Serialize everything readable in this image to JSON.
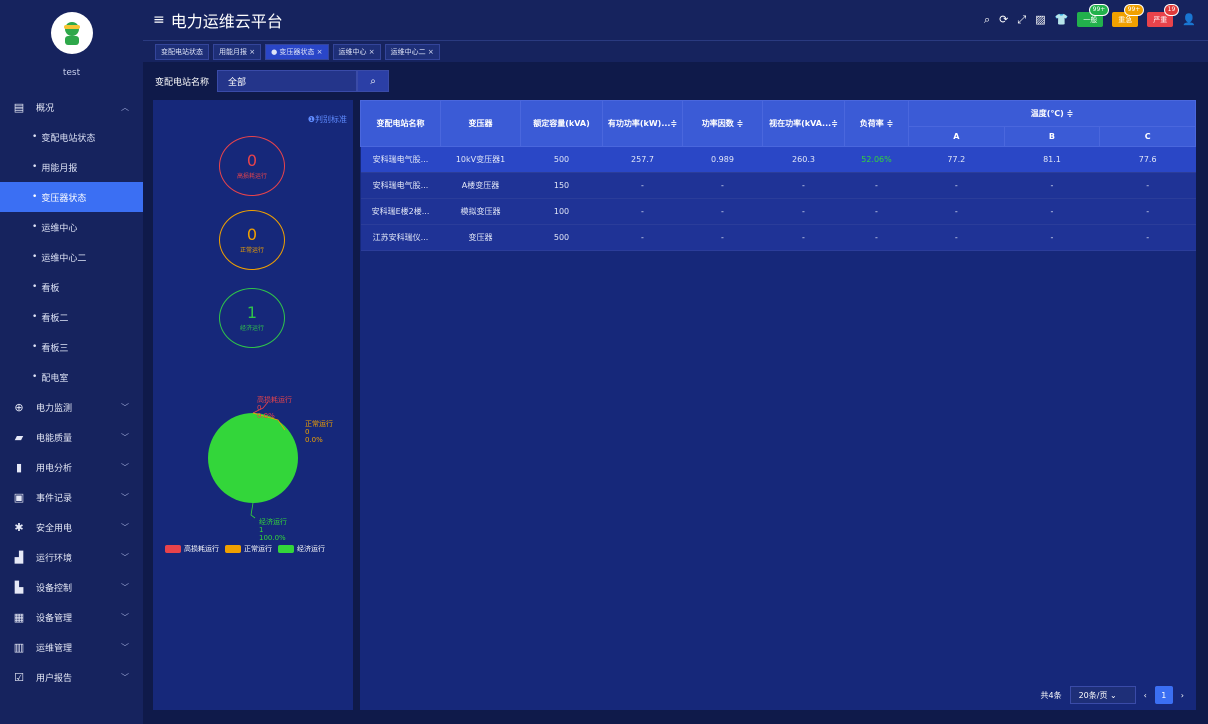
{
  "app": {
    "title": "电力运维云平台",
    "user": "test"
  },
  "sidebar": {
    "overview": "概况",
    "sub": [
      "变配电站状态",
      "用能月报",
      "变压器状态",
      "运维中心",
      "运维中心二",
      "看板",
      "看板二",
      "看板三",
      "配电室"
    ],
    "groups": [
      "电力监测",
      "电能质量",
      "用电分析",
      "事件记录",
      "安全用电",
      "运行环境",
      "设备控制",
      "设备管理",
      "运维管理",
      "用户报告"
    ]
  },
  "tools": {
    "badges": [
      {
        "label": "一般",
        "count": "99+",
        "color": "#22b14c"
      },
      {
        "label": "重急",
        "count": "99+",
        "color": "#f0a000"
      },
      {
        "label": "严重",
        "count": "19",
        "color": "#e8434b"
      }
    ]
  },
  "tabs": [
    "变配电站状态",
    "用能月报 ×",
    "● 变压器状态 ×",
    "运维中心 ×",
    "运维中心二 ×"
  ],
  "filter": {
    "label": "变配电站名称",
    "value": "全部"
  },
  "left": {
    "judge": "❶判别标准",
    "rings": [
      {
        "n": "0",
        "l": "高损耗运行"
      },
      {
        "n": "0",
        "l": "正常运行"
      },
      {
        "n": "1",
        "l": "经济运行"
      }
    ],
    "pie": {
      "high": "高损耗运行\n0\n0.0%",
      "normal": "正常运行\n0\n0.0%",
      "eco": "经济运行\n1\n100.0%"
    },
    "legend": [
      "高损耗运行",
      "正常运行",
      "经济运行"
    ]
  },
  "table": {
    "headers": [
      "变配电站名称",
      "变压器",
      "额定容量(kVA)",
      "有功功率(kW)...≑",
      "功率因数 ≑",
      "视在功率(kVA...≑",
      "负荷率 ≑",
      "温度(℃) ≑"
    ],
    "temp_cols": [
      "A",
      "B",
      "C"
    ],
    "rows": [
      [
        "安科瑞电气股...",
        "10kV变压器1",
        "500",
        "257.7",
        "0.989",
        "260.3",
        "52.06%",
        "77.2",
        "81.1",
        "77.6"
      ],
      [
        "安科瑞电气股...",
        "A楼变压器",
        "150",
        "-",
        "-",
        "-",
        "-",
        "-",
        "-",
        "-"
      ],
      [
        "安科瑞E楼2楼...",
        "模拟变压器",
        "100",
        "-",
        "-",
        "-",
        "-",
        "-",
        "-",
        "-"
      ],
      [
        "江苏安科瑞仪...",
        "变压器",
        "500",
        "-",
        "-",
        "-",
        "-",
        "-",
        "-",
        "-"
      ]
    ]
  },
  "pager": {
    "total": "共4条",
    "size": "20条/页  ⌄",
    "page": "1",
    "prev": "‹",
    "next": "›"
  }
}
